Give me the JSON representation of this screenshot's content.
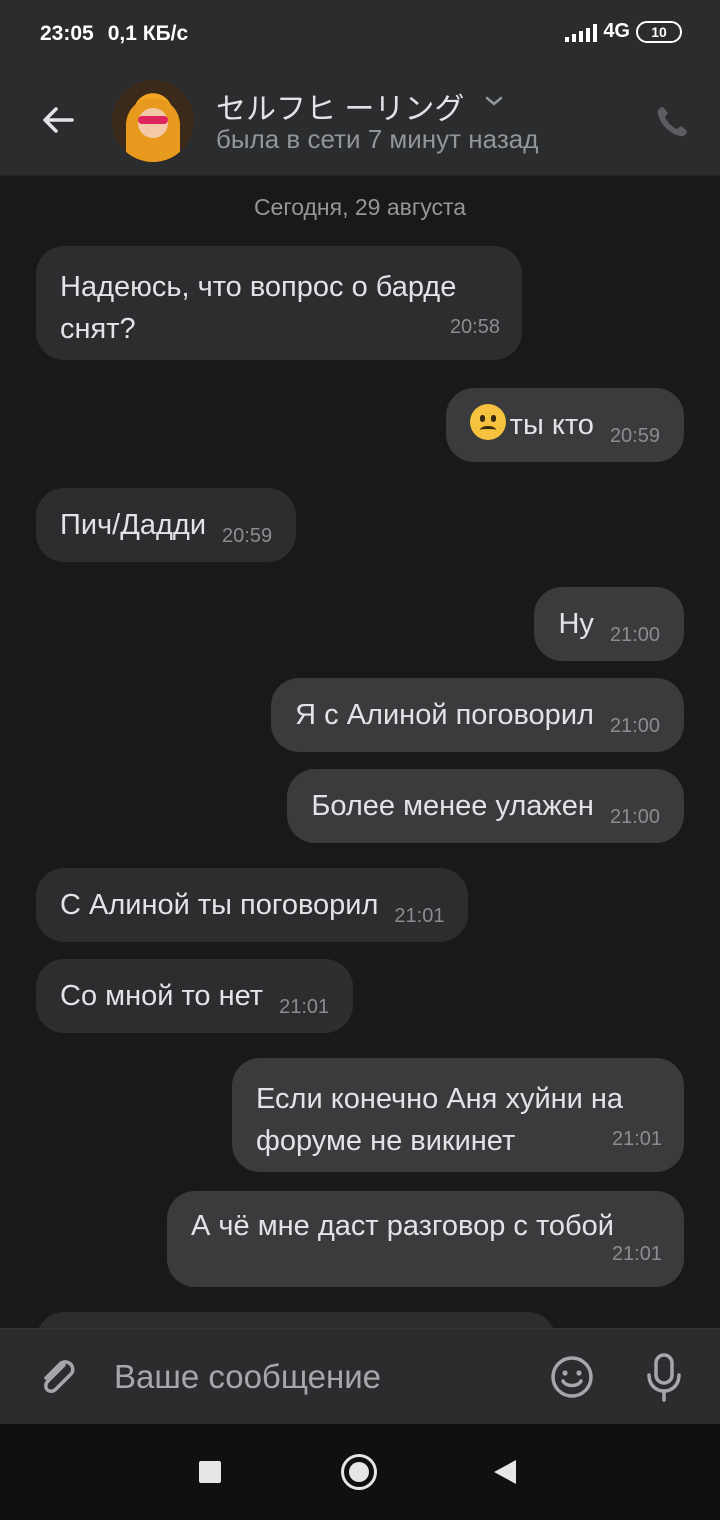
{
  "status_bar": {
    "time": "23:05",
    "speed": "0,1 КБ/с",
    "network": "4G",
    "battery": "10"
  },
  "header": {
    "contact_name": "セルフヒ ーリング",
    "contact_status": "была в сети 7 минут назад"
  },
  "chat": {
    "date_label": "Сегодня, 29 августа",
    "messages": [
      {
        "dir": "in",
        "text": "Надеюсь, что вопрос о барде снят?",
        "time": "20:58"
      },
      {
        "dir": "out",
        "text": "ты кто",
        "emoji": "sad-face-emoji",
        "time": "20:59"
      },
      {
        "dir": "in",
        "text": "Пич/Дадди",
        "time": "20:59"
      },
      {
        "dir": "out",
        "text": "Ну",
        "time": "21:00"
      },
      {
        "dir": "out",
        "text": "Я с Алиной поговорил",
        "time": "21:00"
      },
      {
        "dir": "out",
        "text": "Более менее улажен",
        "time": "21:00"
      },
      {
        "dir": "in",
        "text": "С Алиной ты поговорил",
        "time": "21:01"
      },
      {
        "dir": "in",
        "text": "Со мной то нет",
        "time": "21:01"
      },
      {
        "dir": "out",
        "text": "Если конечно Аня хуйни на форуме не викинет",
        "time": "21:01"
      },
      {
        "dir": "out",
        "text": "А чё мне даст разговор с тобой",
        "time": "21:01"
      }
    ]
  },
  "composer": {
    "placeholder": "Ваше сообщение"
  },
  "colors": {
    "background": "#19191a",
    "bar": "#2b2c2e",
    "bubble_in": "#2c2d2e",
    "bubble_out": "#3a3b3c",
    "text": "#e1e3e6",
    "muted": "#939699"
  }
}
